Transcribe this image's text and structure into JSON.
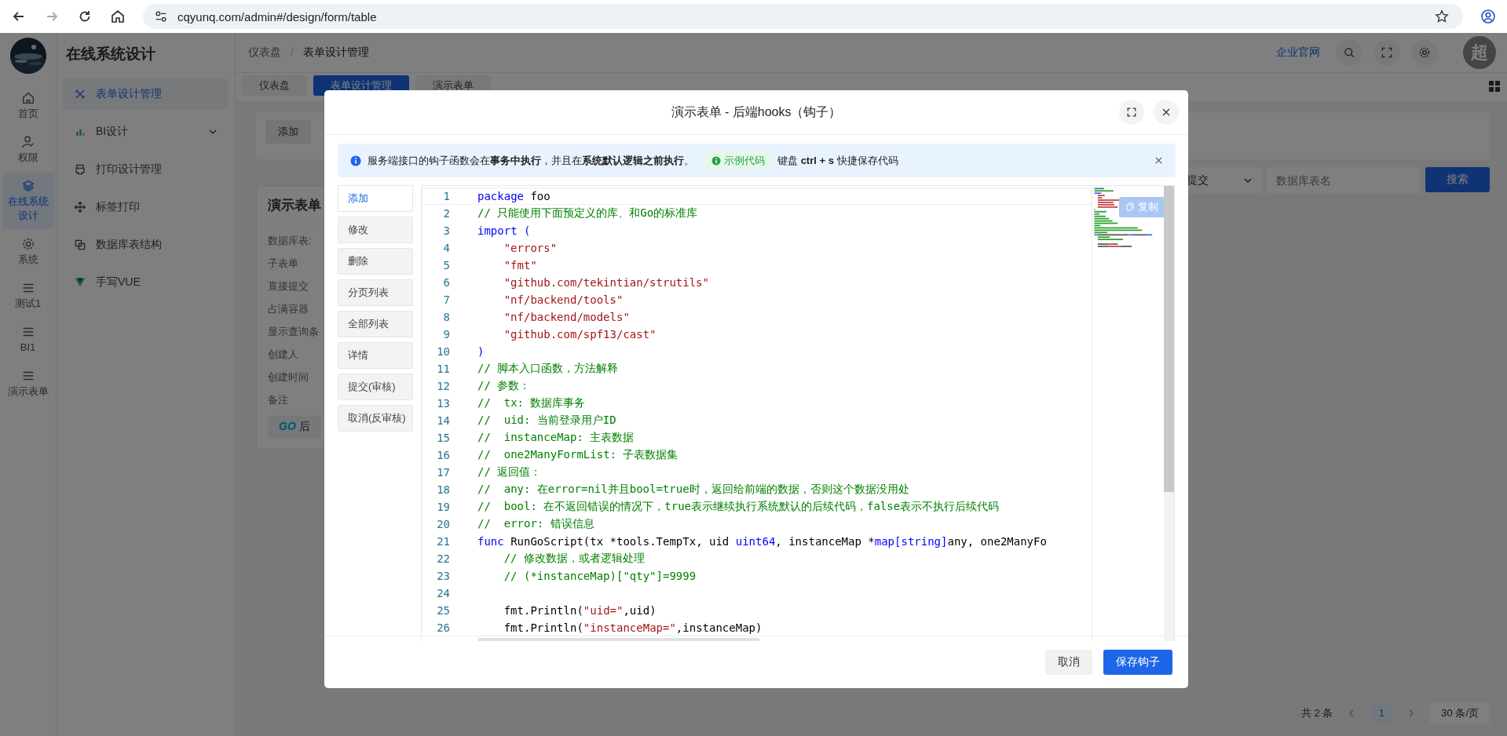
{
  "browser": {
    "url": "cqyunq.com/admin#/design/form/table"
  },
  "app": {
    "title": "在线系统设计",
    "breadcrumbs": [
      "仪表盘",
      "表单设计管理"
    ],
    "breadcrumb_separator": "/",
    "header_link": "企业官网",
    "avatar": "超"
  },
  "rail": [
    {
      "label": "首页",
      "selected": false
    },
    {
      "label": "权限",
      "selected": false
    },
    {
      "label": "在线系统设计",
      "selected": true
    },
    {
      "label": "系统",
      "selected": false
    },
    {
      "label": "测试1",
      "selected": false
    },
    {
      "label": "BI1",
      "selected": false
    },
    {
      "label": "演示表单",
      "selected": false
    }
  ],
  "menu": [
    {
      "label": "表单设计管理",
      "selected": true,
      "has_submenu": false
    },
    {
      "label": "BI设计",
      "selected": false,
      "has_submenu": true
    },
    {
      "label": "打印设计管理",
      "selected": false,
      "has_submenu": false
    },
    {
      "label": "标签打印",
      "selected": false,
      "has_submenu": false
    },
    {
      "label": "数据库表结构",
      "selected": false,
      "has_submenu": false
    },
    {
      "label": "手写VUE",
      "selected": false,
      "has_submenu": false
    }
  ],
  "tabs": [
    {
      "label": "仪表盘",
      "selected": false
    },
    {
      "label": "表单设计管理",
      "selected": true
    },
    {
      "label": "演示表单",
      "selected": false
    }
  ],
  "add_button": "添加",
  "card": {
    "title": "演示表单",
    "fields": [
      "数据库表:",
      "子表单",
      "直接提交",
      "占满容器",
      "显示查询条",
      "创建人",
      "创建时间",
      "备注"
    ],
    "go_button": {
      "logo": "GO",
      "label": "后"
    }
  },
  "filters": {
    "status": "提交",
    "search_placeholder": "数据库表名",
    "search_button": "搜索"
  },
  "pagination": {
    "total": "共 2 条",
    "pages": [
      {
        "label": "1",
        "selected": true
      }
    ],
    "page_size": "30 条/页"
  },
  "dialog": {
    "title": "演示表单 - 后端hooks（钩子）",
    "alert": {
      "text": "服务端接口的钩子函数会在**事务中执行**，并且在**系统默认逻辑之前执行**。",
      "tag": "示例代码",
      "hint": "键盘 **ctrl + s** 快捷保存代码"
    },
    "hooks": [
      {
        "label": "添加",
        "selected": true
      },
      {
        "label": "修改",
        "selected": false
      },
      {
        "label": "删除",
        "selected": false
      },
      {
        "label": "分页列表",
        "selected": false
      },
      {
        "label": "全部列表",
        "selected": false
      },
      {
        "label": "详情",
        "selected": false
      },
      {
        "label": "提交(审核)",
        "selected": false
      },
      {
        "label": "取消(反审核)",
        "selected": false
      }
    ],
    "copy_button": "复制",
    "code": [
      {
        "n": "1",
        "indented": false,
        "tokens": [
          {
            "kind": "keyword",
            "t": "package"
          },
          {
            "kind": "plain",
            "t": " foo"
          }
        ]
      },
      {
        "n": "2",
        "indented": false,
        "tokens": [
          {
            "kind": "comment",
            "t": "// 只能使用下面预定义的库、和Go的标准库"
          }
        ]
      },
      {
        "n": "3",
        "indented": false,
        "tokens": [
          {
            "kind": "keyword",
            "t": "import ("
          }
        ]
      },
      {
        "n": "4",
        "indented": true,
        "tokens": [
          {
            "kind": "string",
            "t": "\"errors\""
          }
        ]
      },
      {
        "n": "5",
        "indented": true,
        "tokens": [
          {
            "kind": "string",
            "t": "\"fmt\""
          }
        ]
      },
      {
        "n": "6",
        "indented": true,
        "tokens": [
          {
            "kind": "string",
            "t": "\"github.com/tekintian/strutils\""
          }
        ]
      },
      {
        "n": "7",
        "indented": true,
        "tokens": [
          {
            "kind": "string",
            "t": "\"nf/backend/tools\""
          }
        ]
      },
      {
        "n": "8",
        "indented": true,
        "tokens": [
          {
            "kind": "string",
            "t": "\"nf/backend/models\""
          }
        ]
      },
      {
        "n": "9",
        "indented": true,
        "tokens": [
          {
            "kind": "string",
            "t": "\"github.com/spf13/cast\""
          }
        ]
      },
      {
        "n": "10",
        "indented": false,
        "tokens": [
          {
            "kind": "keyword",
            "t": ")"
          }
        ]
      },
      {
        "n": "11",
        "indented": false,
        "tokens": [
          {
            "kind": "comment",
            "t": "// 脚本入口函数，方法解释"
          }
        ]
      },
      {
        "n": "12",
        "indented": false,
        "tokens": [
          {
            "kind": "comment",
            "t": "// 参数："
          }
        ]
      },
      {
        "n": "13",
        "indented": false,
        "tokens": [
          {
            "kind": "comment",
            "t": "//  tx: 数据库事务"
          }
        ]
      },
      {
        "n": "14",
        "indented": false,
        "tokens": [
          {
            "kind": "comment",
            "t": "//  uid: 当前登录用户ID"
          }
        ]
      },
      {
        "n": "15",
        "indented": false,
        "tokens": [
          {
            "kind": "comment",
            "t": "//  instanceMap: 主表数据"
          }
        ]
      },
      {
        "n": "16",
        "indented": false,
        "tokens": [
          {
            "kind": "comment",
            "t": "//  one2ManyFormList: 子表数据集"
          }
        ]
      },
      {
        "n": "17",
        "indented": false,
        "tokens": [
          {
            "kind": "comment",
            "t": "// 返回值："
          }
        ]
      },
      {
        "n": "18",
        "indented": false,
        "tokens": [
          {
            "kind": "comment",
            "t": "//  any: 在error=nil并且bool=true时，返回给前端的数据，否则这个数据没用处"
          }
        ]
      },
      {
        "n": "19",
        "indented": false,
        "tokens": [
          {
            "kind": "comment",
            "t": "//  bool: 在不返回错误的情况下，true表示继续执行系统默认的后续代码，false表示不执行后续代码"
          }
        ]
      },
      {
        "n": "20",
        "indented": false,
        "tokens": [
          {
            "kind": "comment",
            "t": "//  error: 错误信息"
          }
        ]
      },
      {
        "n": "21",
        "indented": false,
        "tokens": [
          {
            "kind": "keyword",
            "t": "func"
          },
          {
            "kind": "plain",
            "t": " RunGoScript(tx *tools.TempTx, uid "
          },
          {
            "kind": "keyword",
            "t": "uint64"
          },
          {
            "kind": "plain",
            "t": ", instanceMap *"
          },
          {
            "kind": "keyword",
            "t": "map[string]"
          },
          {
            "kind": "plain",
            "t": "any, one2ManyFo"
          }
        ]
      },
      {
        "n": "22",
        "indented": true,
        "tokens": [
          {
            "kind": "comment",
            "t": "// 修改数据，或者逻辑处理"
          }
        ]
      },
      {
        "n": "23",
        "indented": true,
        "tokens": [
          {
            "kind": "comment",
            "t": "// (*instanceMap)[\"qty\"]=9999"
          }
        ]
      },
      {
        "n": "24"
      },
      {
        "n": "25",
        "indented": true,
        "tokens": [
          {
            "kind": "plain",
            "t": "fmt.Println("
          },
          {
            "kind": "string",
            "t": "\"uid=\""
          },
          {
            "kind": "plain",
            "t": ",uid)"
          }
        ]
      },
      {
        "n": "26",
        "indented": true,
        "tokens": [
          {
            "kind": "plain",
            "t": "fmt.Println("
          },
          {
            "kind": "string",
            "t": "\"instanceMap=\""
          },
          {
            "kind": "plain",
            "t": ",instanceMap)"
          }
        ]
      }
    ],
    "buttons": {
      "cancel": "取消",
      "save": "保存钩子"
    }
  }
}
